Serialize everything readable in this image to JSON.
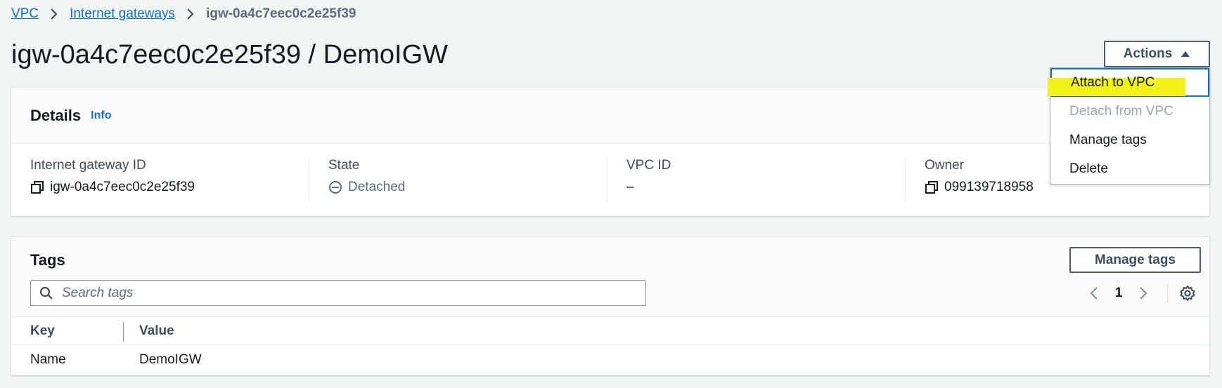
{
  "breadcrumb": {
    "items": [
      "VPC",
      "Internet gateways"
    ],
    "current": "igw-0a4c7eec0c2e25f39"
  },
  "page_title": "igw-0a4c7eec0c2e25f39 / DemoIGW",
  "actions": {
    "label": "Actions",
    "menu": [
      "Attach to VPC",
      "Detach from VPC",
      "Manage tags",
      "Delete"
    ]
  },
  "details": {
    "title": "Details",
    "info": "Info",
    "fields": [
      {
        "label": "Internet gateway ID",
        "value": "igw-0a4c7eec0c2e25f39"
      },
      {
        "label": "State",
        "value": "Detached"
      },
      {
        "label": "VPC ID",
        "value": "–"
      },
      {
        "label": "Owner",
        "value": "099139718958"
      }
    ]
  },
  "tags": {
    "title": "Tags",
    "manage_label": "Manage tags",
    "search_placeholder": "Search tags",
    "page": "1",
    "columns": [
      "Key",
      "Value"
    ],
    "rows": [
      {
        "key": "Name",
        "value": "DemoIGW"
      }
    ]
  },
  "colors": {
    "link": "#0972d3",
    "highlight": "#f2f218",
    "focus": "#0972d3"
  }
}
